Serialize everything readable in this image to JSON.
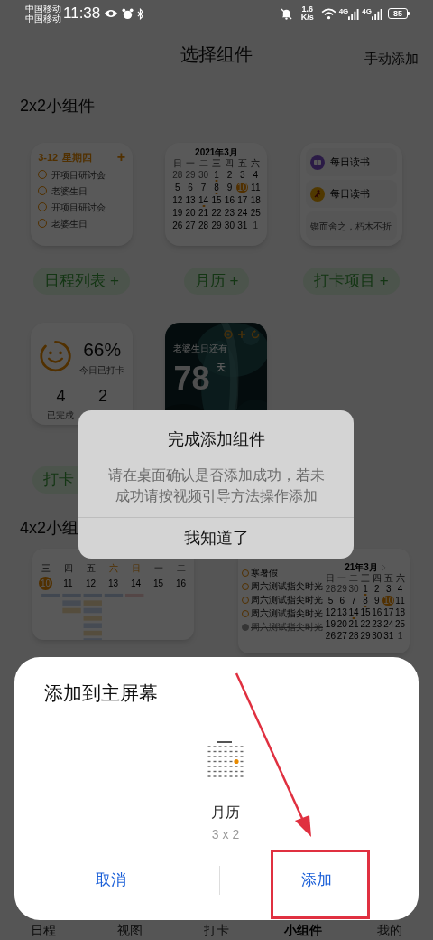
{
  "status_bar": {
    "carrier_1": "中国移动",
    "carrier_2": "中国移动",
    "time": "11:38",
    "speed_value": "1.6",
    "speed_unit": "K/s",
    "signal_1_label": "4G",
    "signal_2_label": "4G",
    "battery": "85"
  },
  "header": {
    "title": "选择组件",
    "action": "手动添加"
  },
  "section_2x2": {
    "title": "2x2小组件"
  },
  "schedule_widget": {
    "date": "3-12",
    "weekday": "星期四",
    "add": "+",
    "items": [
      {
        "text": "开项目研讨会",
        "done": false
      },
      {
        "text": "老婆生日",
        "done": false
      },
      {
        "text": "开项目研讨会",
        "done": false
      },
      {
        "text": "老婆生日",
        "done": false
      }
    ]
  },
  "calendar_widget": {
    "title": "2021年3月",
    "weekdays": [
      "日",
      "一",
      "二",
      "三",
      "四",
      "五",
      "六"
    ],
    "days": [
      {
        "day": "28",
        "muted": true,
        "dot": false,
        "selected": false
      },
      {
        "day": "29",
        "muted": true,
        "dot": false,
        "selected": false
      },
      {
        "day": "30",
        "muted": true,
        "dot": false,
        "selected": false
      },
      {
        "day": "1",
        "muted": false,
        "dot": true,
        "selected": false
      },
      {
        "day": "2",
        "muted": false,
        "dot": false,
        "selected": false
      },
      {
        "day": "3",
        "muted": false,
        "dot": false,
        "selected": false
      },
      {
        "day": "4",
        "muted": false,
        "dot": false,
        "selected": false
      },
      {
        "day": "5",
        "muted": false,
        "dot": false,
        "selected": false
      },
      {
        "day": "6",
        "muted": false,
        "dot": false,
        "selected": false
      },
      {
        "day": "7",
        "muted": false,
        "dot": false,
        "selected": false
      },
      {
        "day": "8",
        "muted": false,
        "dot": true,
        "selected": false
      },
      {
        "day": "9",
        "muted": false,
        "dot": false,
        "selected": false
      },
      {
        "day": "10",
        "muted": false,
        "dot": false,
        "selected": true
      },
      {
        "day": "11",
        "muted": false,
        "dot": false,
        "selected": false
      },
      {
        "day": "12",
        "muted": false,
        "dot": false,
        "selected": false
      },
      {
        "day": "13",
        "muted": false,
        "dot": false,
        "selected": false
      },
      {
        "day": "14",
        "muted": false,
        "dot": true,
        "selected": false
      },
      {
        "day": "15",
        "muted": false,
        "dot": false,
        "selected": false
      },
      {
        "day": "16",
        "muted": false,
        "dot": false,
        "selected": false
      },
      {
        "day": "17",
        "muted": false,
        "dot": false,
        "selected": false
      },
      {
        "day": "18",
        "muted": false,
        "dot": false,
        "selected": false
      },
      {
        "day": "19",
        "muted": false,
        "dot": false,
        "selected": false
      },
      {
        "day": "20",
        "muted": false,
        "dot": false,
        "selected": false
      },
      {
        "day": "21",
        "muted": false,
        "dot": false,
        "selected": false
      },
      {
        "day": "22",
        "muted": false,
        "dot": false,
        "selected": false
      },
      {
        "day": "23",
        "muted": false,
        "dot": false,
        "selected": false
      },
      {
        "day": "24",
        "muted": false,
        "dot": false,
        "selected": false
      },
      {
        "day": "25",
        "muted": false,
        "dot": false,
        "selected": false
      },
      {
        "day": "26",
        "muted": false,
        "dot": false,
        "selected": false
      },
      {
        "day": "27",
        "muted": false,
        "dot": false,
        "selected": false
      },
      {
        "day": "28",
        "muted": false,
        "dot": false,
        "selected": false
      },
      {
        "day": "29",
        "muted": false,
        "dot": false,
        "selected": false
      },
      {
        "day": "30",
        "muted": false,
        "dot": false,
        "selected": false
      },
      {
        "day": "31",
        "muted": false,
        "dot": false,
        "selected": false
      },
      {
        "day": "1",
        "muted": true,
        "dot": false,
        "selected": false
      }
    ]
  },
  "checkin_widget": {
    "items": [
      {
        "kind": "book",
        "text": "每日读书"
      },
      {
        "kind": "figure",
        "text": "每日读书"
      }
    ],
    "quote": "锲而舍之，朽木不折"
  },
  "add_buttons": [
    {
      "label": "日程列表 +"
    },
    {
      "label": "月历 +"
    },
    {
      "label": "打卡项目 +"
    }
  ],
  "stats_widget": {
    "percent": "66%",
    "percent_label": "今日已打卡",
    "stats": [
      {
        "value": "4",
        "label": "已完成"
      },
      {
        "value": "2"
      }
    ]
  },
  "countdown_widget": {
    "kind": "picture",
    "caption": "老婆生日还有",
    "days": "78",
    "unit": "天"
  },
  "add_buttons_2": [
    {
      "label": "打卡"
    }
  ],
  "section_4x2": {
    "title": "4x2小组"
  },
  "week_widget": {
    "weekdays": [
      {
        "text": "三",
        "weekend": false
      },
      {
        "text": "四",
        "weekend": false
      },
      {
        "text": "五",
        "weekend": false
      },
      {
        "text": "六",
        "weekend": true
      },
      {
        "text": "日",
        "weekend": true
      },
      {
        "text": "一",
        "weekend": false
      },
      {
        "text": "二",
        "weekend": false
      }
    ],
    "dates": [
      {
        "text": "10",
        "selected": true
      },
      {
        "text": "11",
        "selected": false
      },
      {
        "text": "12",
        "selected": false
      },
      {
        "text": "13",
        "selected": false
      },
      {
        "text": "14",
        "selected": false
      },
      {
        "text": "15",
        "selected": false
      },
      {
        "text": "16",
        "selected": false
      }
    ]
  },
  "list_calendar_widget": {
    "items": [
      {
        "text": "寒暑假",
        "done": false
      },
      {
        "text": "周六测试指尖时光",
        "done": false
      },
      {
        "text": "周六测试指尖时光",
        "done": false
      },
      {
        "text": "周六测试指尖时光",
        "done": false
      },
      {
        "text": "周六测试指尖时光",
        "done": true
      }
    ],
    "calendar": {
      "title": "21年3月",
      "weekdays": [
        "日",
        "一",
        "二",
        "三",
        "四",
        "五",
        "六"
      ],
      "days": [
        {
          "day": "28",
          "muted": true,
          "dot": false,
          "selected": false
        },
        {
          "day": "29",
          "muted": true,
          "dot": false,
          "selected": false
        },
        {
          "day": "30",
          "muted": true,
          "dot": false,
          "selected": false
        },
        {
          "day": "1",
          "muted": false,
          "dot": true,
          "selected": false
        },
        {
          "day": "2",
          "muted": false,
          "dot": false,
          "selected": false
        },
        {
          "day": "3",
          "muted": false,
          "dot": false,
          "selected": false
        },
        {
          "day": "4",
          "muted": false,
          "dot": false,
          "selected": false
        },
        {
          "day": "5",
          "muted": false,
          "dot": false,
          "selected": false
        },
        {
          "day": "6",
          "muted": false,
          "dot": false,
          "selected": false
        },
        {
          "day": "7",
          "muted": false,
          "dot": false,
          "selected": false
        },
        {
          "day": "8",
          "muted": false,
          "dot": true,
          "selected": false
        },
        {
          "day": "9",
          "muted": false,
          "dot": false,
          "selected": false
        },
        {
          "day": "10",
          "muted": false,
          "dot": false,
          "selected": true
        },
        {
          "day": "11",
          "muted": false,
          "dot": false,
          "selected": false
        },
        {
          "day": "12",
          "muted": false,
          "dot": false,
          "selected": false
        },
        {
          "day": "13",
          "muted": false,
          "dot": false,
          "selected": false
        },
        {
          "day": "14",
          "muted": false,
          "dot": true,
          "selected": false
        },
        {
          "day": "15",
          "muted": false,
          "dot": false,
          "selected": false
        },
        {
          "day": "16",
          "muted": false,
          "dot": false,
          "selected": false
        },
        {
          "day": "17",
          "muted": false,
          "dot": false,
          "selected": false
        },
        {
          "day": "18",
          "muted": false,
          "dot": false,
          "selected": false
        },
        {
          "day": "19",
          "muted": false,
          "dot": false,
          "selected": false
        },
        {
          "day": "20",
          "muted": false,
          "dot": false,
          "selected": false
        },
        {
          "day": "21",
          "muted": false,
          "dot": false,
          "selected": false
        },
        {
          "day": "22",
          "muted": false,
          "dot": false,
          "selected": false
        },
        {
          "day": "23",
          "muted": false,
          "dot": false,
          "selected": false
        },
        {
          "day": "24",
          "muted": false,
          "dot": false,
          "selected": false
        },
        {
          "day": "25",
          "muted": false,
          "dot": false,
          "selected": false
        },
        {
          "day": "26",
          "muted": false,
          "dot": false,
          "selected": false
        },
        {
          "day": "27",
          "muted": false,
          "dot": false,
          "selected": false
        },
        {
          "day": "28",
          "muted": false,
          "dot": false,
          "selected": false
        },
        {
          "day": "29",
          "muted": false,
          "dot": false,
          "selected": false
        },
        {
          "day": "30",
          "muted": false,
          "dot": false,
          "selected": false
        },
        {
          "day": "31",
          "muted": false,
          "dot": false,
          "selected": false
        },
        {
          "day": "1",
          "muted": true,
          "dot": false,
          "selected": false
        }
      ]
    }
  },
  "dialog": {
    "title": "完成添加组件",
    "message": "请在桌面确认是否添加成功，若未成功请按视频引导方法操作添加",
    "button": "我知道了"
  },
  "sheet": {
    "title": "添加到主屏幕",
    "widget_name": "月历",
    "widget_size": "3 x 2",
    "buttons": [
      {
        "label": "取消"
      },
      {
        "label": "添加"
      }
    ]
  },
  "bottom_nav": [
    {
      "label": "日程",
      "selected": false
    },
    {
      "label": "视图",
      "selected": false
    },
    {
      "label": "打卡",
      "selected": false
    },
    {
      "label": "小组件",
      "selected": true
    },
    {
      "label": "我的",
      "selected": false
    }
  ]
}
